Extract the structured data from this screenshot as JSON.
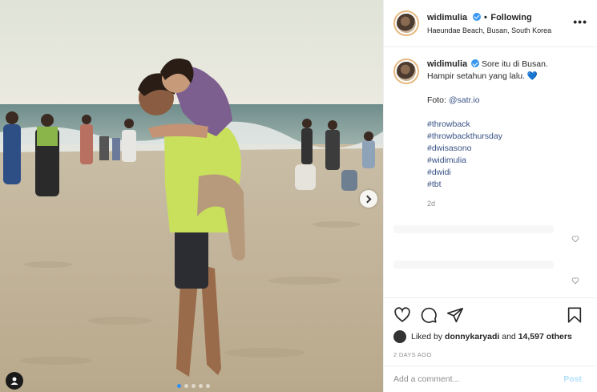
{
  "header": {
    "username": "widimulia",
    "separator": "•",
    "follow_status": "Following",
    "location": "Haeundae Beach, Busan, South Korea",
    "more_icon": "more-horizontal-icon",
    "verified_icon": "verified-badge-icon"
  },
  "caption": {
    "username": "widimulia",
    "line1": "Sore itu di Busan.",
    "line2": "Hampir setahun yang lalu.",
    "emoji": "💙",
    "foto_label": "Foto:",
    "foto_mention": "@satr.io",
    "hashtags": [
      "#throwback",
      "#throwbackthursday",
      "#dwisasono",
      "#widimulia",
      "#dwidi",
      "#tbt"
    ],
    "age": "2d"
  },
  "actions": {
    "like_icon": "heart-icon",
    "comment_icon": "comment-icon",
    "share_icon": "paper-plane-icon",
    "save_icon": "bookmark-icon"
  },
  "likes": {
    "prefix": "Liked by",
    "user": "donnykaryadi",
    "and": "and",
    "count": "14,597 others"
  },
  "date": "2 DAYS AGO",
  "comment_box": {
    "placeholder": "Add a comment...",
    "post_label": "Post"
  },
  "carousel": {
    "slides": 5,
    "active": 1
  },
  "colors": {
    "link": "#385185",
    "verified": "#3897f0",
    "post_disabled": "#b2dffc",
    "muted": "#8e8e8e"
  }
}
